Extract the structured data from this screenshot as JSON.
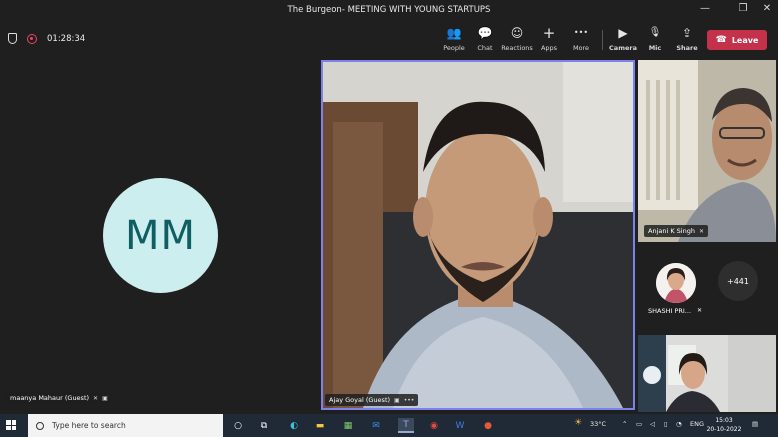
{
  "window": {
    "title": "The Burgeon- MEETING WITH YOUNG STARTUPS",
    "minimize_glyph": "—",
    "maximize_glyph": "❐",
    "close_glyph": "✕"
  },
  "toolbar": {
    "timer": "01:28:34",
    "buttons": [
      {
        "label": "People",
        "icon": "people-icon",
        "glyph": "👥"
      },
      {
        "label": "Chat",
        "icon": "chat-icon",
        "glyph": "💬"
      },
      {
        "label": "Reactions",
        "icon": "reactions-icon",
        "glyph": "☺"
      },
      {
        "label": "Apps",
        "icon": "apps-icon",
        "glyph": "+"
      },
      {
        "label": "More",
        "icon": "more-icon",
        "glyph": "•••"
      },
      {
        "label": "Camera",
        "icon": "camera-icon",
        "glyph": "▶"
      },
      {
        "label": "Mic",
        "icon": "mic-off-icon",
        "glyph": "🎙"
      },
      {
        "label": "Share",
        "icon": "share-icon",
        "glyph": "⇪"
      }
    ],
    "leave_label": "Leave",
    "leave_glyph": "☎",
    "accent_color": "#c4314b"
  },
  "participants": {
    "avatar_initials": "MM",
    "avatar_name": "maanya Mahaur (Guest)",
    "main_name": "Ajay Goyal (Guest)",
    "right_name": "Anjani K Singh",
    "mini_name": "SHASHI PRI...",
    "more_count": "+441",
    "highlight_color": "#7b83eb"
  },
  "taskbar": {
    "search_placeholder": "Type here to search",
    "weather": "33°C",
    "language": "ENG",
    "time": "15:03",
    "date": "20-10-2022"
  }
}
